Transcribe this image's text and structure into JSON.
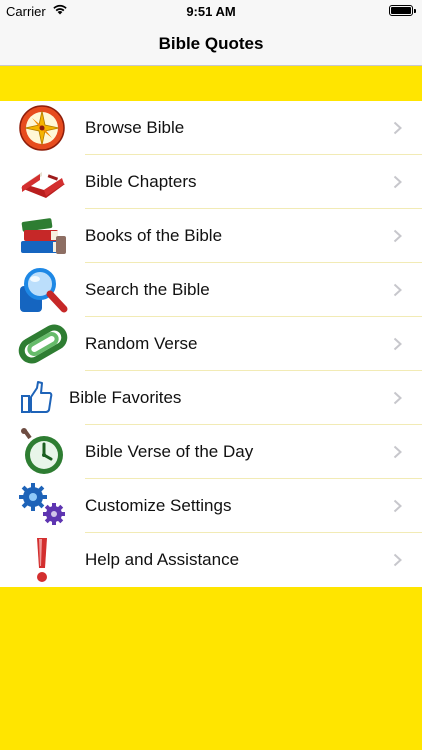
{
  "status_bar": {
    "carrier": "Carrier",
    "time": "9:51 AM",
    "battery_level": 1.0
  },
  "nav": {
    "title": "Bible Quotes"
  },
  "colors": {
    "background": "#FFE500",
    "navbar": "#F7F7F7",
    "separator": "#F2EBB5",
    "chevron": "#C7C7CC"
  },
  "menu": [
    {
      "label": "Browse Bible",
      "icon": "compass-icon"
    },
    {
      "label": "Bible Chapters",
      "icon": "open-book-icon"
    },
    {
      "label": "Books of the Bible",
      "icon": "books-stack-icon"
    },
    {
      "label": "Search the Bible",
      "icon": "magnifier-icon"
    },
    {
      "label": "Random Verse",
      "icon": "paperclip-icon"
    },
    {
      "label": "Bible Favorites",
      "icon": "thumbs-up-icon"
    },
    {
      "label": "Bible Verse of the Day",
      "icon": "stopwatch-icon"
    },
    {
      "label": "Customize Settings",
      "icon": "gears-icon"
    },
    {
      "label": "Help and Assistance",
      "icon": "exclamation-icon"
    }
  ]
}
